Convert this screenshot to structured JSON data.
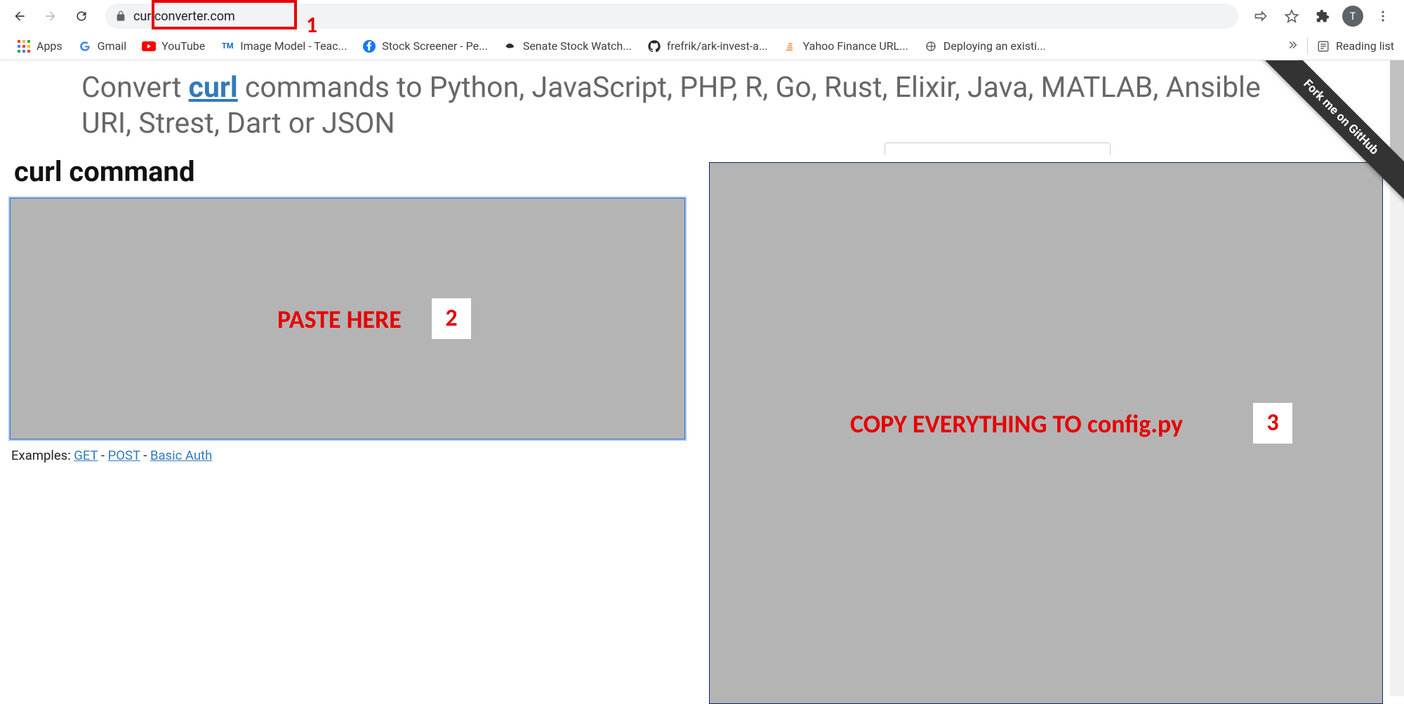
{
  "browser": {
    "url": "curlconverter.com",
    "avatar_letter": "T"
  },
  "bookmarks": [
    {
      "label": "Apps",
      "icon": "apps"
    },
    {
      "label": "Gmail",
      "icon": "google"
    },
    {
      "label": "YouTube",
      "icon": "youtube"
    },
    {
      "label": "Image Model - Teac...",
      "icon": "tm"
    },
    {
      "label": "Stock Screener - Pe...",
      "icon": "fb"
    },
    {
      "label": "Senate Stock Watch...",
      "icon": "eagle"
    },
    {
      "label": "frefrik/ark-invest-a...",
      "icon": "github"
    },
    {
      "label": "Yahoo Finance URL...",
      "icon": "stack"
    },
    {
      "label": "Deploying an existi...",
      "icon": "deploy"
    }
  ],
  "reading_list_label": "Reading list",
  "page": {
    "headline_prefix": "Convert ",
    "headline_link": "curl",
    "headline_suffix": " commands to Python, JavaScript, PHP, R, Go, Rust, Elixir, Java, MATLAB, Ansible URI, Strest, Dart or JSON",
    "section_title": "curl command",
    "examples_label": "Examples: ",
    "examples": [
      "GET",
      "POST",
      "Basic Auth"
    ],
    "ribbon": "Fork me on GitHub"
  },
  "annotations": {
    "n1": "1",
    "paste_label": "PASTE HERE",
    "n2": "2",
    "copy_label": "COPY EVERYTHING TO config.py",
    "n3": "3"
  }
}
